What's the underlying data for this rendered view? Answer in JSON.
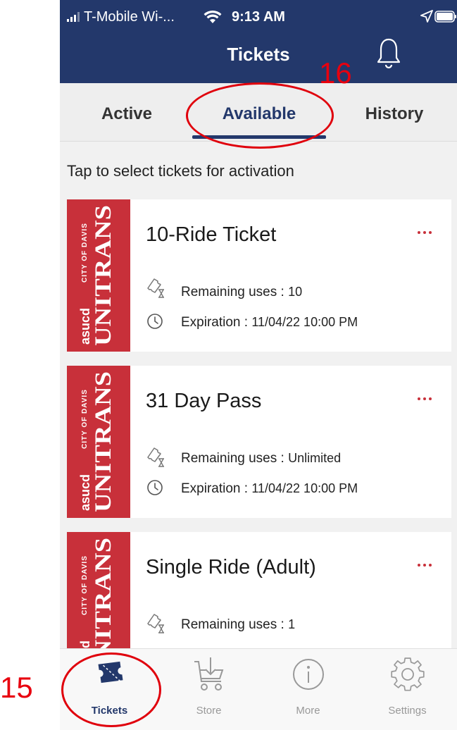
{
  "status_bar": {
    "carrier": "T-Mobile Wi-...",
    "time": "9:13 AM"
  },
  "header": {
    "title": "Tickets"
  },
  "tabs": [
    {
      "label": "Active"
    },
    {
      "label": "Available",
      "selected": true
    },
    {
      "label": "History"
    }
  ],
  "instruction": "Tap to select tickets for activation",
  "logo": {
    "top_text": "CITY OF DAVIS",
    "brand": "UNITRANS",
    "sub": "asucd"
  },
  "cards": [
    {
      "title": "10-Ride Ticket",
      "uses_label": "Remaining uses : ",
      "uses_value": "10",
      "exp_label": "Expiration : ",
      "exp_value": "11/04/22 10:00 PM"
    },
    {
      "title": "31 Day Pass",
      "uses_label": "Remaining uses : ",
      "uses_value": "Unlimited",
      "exp_label": "Expiration : ",
      "exp_value": "11/04/22 10:00 PM"
    },
    {
      "title": "Single Ride (Adult)",
      "uses_label": "Remaining uses : ",
      "uses_value": "1"
    }
  ],
  "tabbar": [
    {
      "label": "Tickets",
      "icon": "ticket-icon",
      "selected": true
    },
    {
      "label": "Store",
      "icon": "store-download-cart-icon"
    },
    {
      "label": "More",
      "icon": "info-icon"
    },
    {
      "label": "Settings",
      "icon": "gear-icon"
    }
  ],
  "annotations": {
    "tab_marker": "16",
    "nav_marker": "15"
  },
  "colors": {
    "header": "#23386b",
    "brand_red": "#c8303a",
    "annotation": "#e8000e"
  }
}
